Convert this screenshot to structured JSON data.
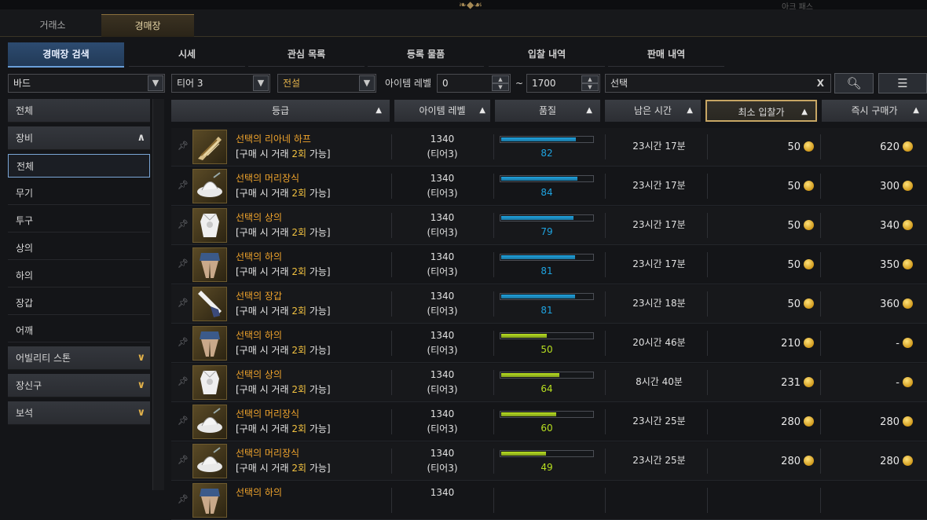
{
  "top": {
    "corner_label": "아크 패스"
  },
  "main_tabs": [
    {
      "label": "거래소",
      "active": false
    },
    {
      "label": "경매장",
      "active": true
    }
  ],
  "sub_tabs": [
    {
      "label": "경매장 검색",
      "active": true
    },
    {
      "label": "시세",
      "active": false
    },
    {
      "label": "관심 목록",
      "active": false
    },
    {
      "label": "등록 물품",
      "active": false
    },
    {
      "label": "입찰 내역",
      "active": false
    },
    {
      "label": "판매 내역",
      "active": false
    }
  ],
  "filters": {
    "class": "바드",
    "tier": "티어 3",
    "grade": "전설",
    "item_level_label": "아이템 레벨",
    "level_min": "0",
    "range_sep": "~",
    "level_max": "1700",
    "search_text": "선택",
    "clear_glyph": "X"
  },
  "sidebar": [
    {
      "label": "전체",
      "kind": "cat"
    },
    {
      "label": "장비",
      "kind": "cat",
      "expanded": true
    },
    {
      "label": "전체",
      "kind": "sub",
      "selected": true
    },
    {
      "label": "무기",
      "kind": "sub"
    },
    {
      "label": "투구",
      "kind": "sub"
    },
    {
      "label": "상의",
      "kind": "sub"
    },
    {
      "label": "하의",
      "kind": "sub"
    },
    {
      "label": "장갑",
      "kind": "sub"
    },
    {
      "label": "어깨",
      "kind": "sub"
    },
    {
      "label": "어빌리티 스톤",
      "kind": "cat"
    },
    {
      "label": "장신구",
      "kind": "cat"
    },
    {
      "label": "보석",
      "kind": "cat"
    }
  ],
  "columns": {
    "grade": "등급",
    "item_level": "아이템 레벨",
    "quality": "품질",
    "time_left": "남은 시간",
    "min_bid": "최소 입찰가",
    "buy_now": "즉시 구매가"
  },
  "note": {
    "prefix": "[구매 시 거래 ",
    "count": "2회",
    "suffix": " 가능]"
  },
  "colors": {
    "quality_blue": "#1fa3e0",
    "quality_green": "#b8e020",
    "item_legend": "#f0a42c"
  },
  "rows": [
    {
      "name": "선택의 리아네 하프",
      "icon": "harp-icon",
      "level": "1340",
      "tier": "(티어3)",
      "quality": 82,
      "quality_text": "82",
      "time": "23시간 17분",
      "bid": "50",
      "buy": "620"
    },
    {
      "name": "선택의 머리장식",
      "icon": "hat-icon",
      "level": "1340",
      "tier": "(티어3)",
      "quality": 84,
      "quality_text": "84",
      "time": "23시간 17분",
      "bid": "50",
      "buy": "300"
    },
    {
      "name": "선택의 상의",
      "icon": "top-icon",
      "level": "1340",
      "tier": "(티어3)",
      "quality": 79,
      "quality_text": "79",
      "time": "23시간 17분",
      "bid": "50",
      "buy": "340"
    },
    {
      "name": "선택의 하의",
      "icon": "pants-icon",
      "level": "1340",
      "tier": "(티어3)",
      "quality": 81,
      "quality_text": "81",
      "time": "23시간 17분",
      "bid": "50",
      "buy": "350"
    },
    {
      "name": "선택의 장갑",
      "icon": "glove-icon",
      "level": "1340",
      "tier": "(티어3)",
      "quality": 81,
      "quality_text": "81",
      "time": "23시간 18분",
      "bid": "50",
      "buy": "360"
    },
    {
      "name": "선택의 하의",
      "icon": "pants-icon",
      "level": "1340",
      "tier": "(티어3)",
      "quality": 50,
      "quality_text": "50",
      "time": "20시간 46분",
      "bid": "210",
      "buy": "-"
    },
    {
      "name": "선택의 상의",
      "icon": "top-icon",
      "level": "1340",
      "tier": "(티어3)",
      "quality": 64,
      "quality_text": "64",
      "time": "8시간 40분",
      "bid": "231",
      "buy": "-"
    },
    {
      "name": "선택의 머리장식",
      "icon": "hat-icon",
      "level": "1340",
      "tier": "(티어3)",
      "quality": 60,
      "quality_text": "60",
      "time": "23시간 25분",
      "bid": "280",
      "buy": "280"
    },
    {
      "name": "선택의 머리장식",
      "icon": "hat-icon",
      "level": "1340",
      "tier": "(티어3)",
      "quality": 49,
      "quality_text": "49",
      "time": "23시간 25분",
      "bid": "280",
      "buy": "280"
    },
    {
      "name": "선택의 하의",
      "icon": "pants-icon",
      "level": "1340",
      "tier": "",
      "quality": 0,
      "quality_text": "",
      "time": "",
      "bid": "",
      "buy": ""
    }
  ]
}
